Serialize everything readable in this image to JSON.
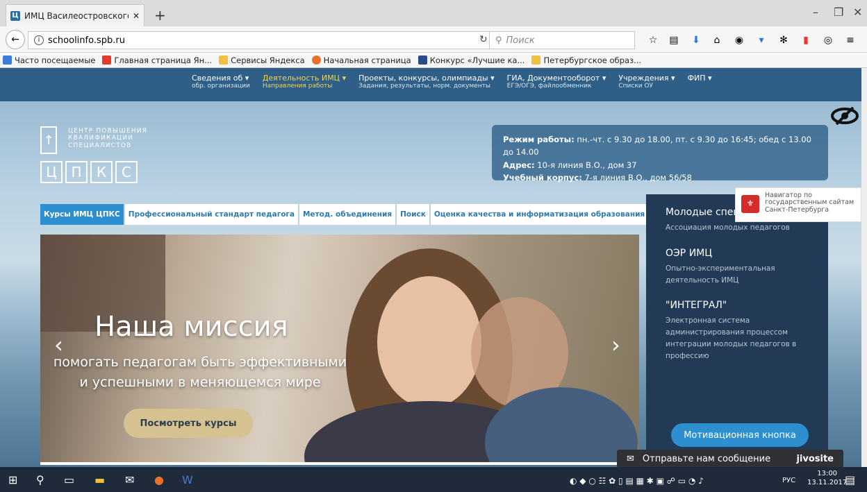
{
  "browser": {
    "tab_title": "ИМЦ Василеостровского р",
    "tab_favicon": "Ц",
    "url": "schoolinfo.spb.ru",
    "search_placeholder": "Поиск"
  },
  "bookmarks": [
    {
      "label": "Часто посещаемые",
      "color": "#3b7dd8"
    },
    {
      "label": "Главная страница Ян...",
      "color": "#e33b2e"
    },
    {
      "label": "Сервисы Яндекса",
      "color": "#f0c040"
    },
    {
      "label": "Начальная страница",
      "color": "#e8702a"
    },
    {
      "label": "Конкурс «Лучшие ка...",
      "color": "#2a4a8a"
    },
    {
      "label": "Петербургское образ...",
      "color": "#f0c040"
    }
  ],
  "site_nav": [
    {
      "title": "Сведения об ▾",
      "sub": "обр. организации"
    },
    {
      "title": "Деятельность ИМЦ ▾",
      "sub": "Направления работы"
    },
    {
      "title": "Проекты, конкурсы, олимпиады ▾",
      "sub": "Задания, результаты, норм. документы"
    },
    {
      "title": "ГИА, Документооборот ▾",
      "sub": "ЕГЭ/ОГЭ, файлообменник"
    },
    {
      "title": "Учреждения ▾",
      "sub": "Списки ОУ"
    },
    {
      "title": "ФИП ▾",
      "sub": ""
    }
  ],
  "logo": {
    "line1": "ЦЕНТР ПОВЫШЕНИЯ",
    "line2": "КВАЛИФИКАЦИИ",
    "line3": "СПЕЦИАЛИСТОВ",
    "letters": [
      "Ц",
      "П",
      "К",
      "С"
    ]
  },
  "info": {
    "hours_label": "Режим работы:",
    "hours": " пн.-чт. с 9.30 до 18.00, пт. с 9.30 до 16:45; обед с 13.00 до 14.00",
    "address_label": "Адрес:",
    "address": " 10-я линия В.О., дом 37",
    "building_label": "Учебный корпус:",
    "building": " 7-я линия В.О., дом 56/58"
  },
  "navigator_widget": {
    "text": "Навигатор по государственным сайтам Санкт-Петербурга"
  },
  "tabs": [
    {
      "label": "Курсы ИМЦ ЦПКС",
      "active": true
    },
    {
      "label": "Профессиональный стандарт педагога",
      "active": false
    },
    {
      "label": "Метод. объединения",
      "active": false
    },
    {
      "label": "Поиск",
      "active": false
    },
    {
      "label": "Оценка качества и информатизация образования",
      "active": false
    }
  ],
  "slide": {
    "heading": "Наша миссия",
    "line1": "помогать педагогам быть эффективными",
    "line2": "и успешными в меняющемся мире",
    "button": "Посмотреть курсы"
  },
  "right_panel": [
    {
      "title": "Молодые спец",
      "desc": "Ассоциация молодых педагогов"
    },
    {
      "title": "ОЭР ИМЦ",
      "desc": "Опытно-экспериментальная деятельность ИМЦ"
    },
    {
      "title": "\"ИНТЕГРАЛ\"",
      "desc": "Электронная система администрирования процессом интеграции молодых педагогов в профессию"
    }
  ],
  "motivation_button": "Мотивационная кнопка",
  "jivo": {
    "message": "Отправьте нам сообщение",
    "brand": "jivosite"
  },
  "taskbar": {
    "lang": "РУС",
    "time": "13:00",
    "date": "13.11.2017"
  }
}
